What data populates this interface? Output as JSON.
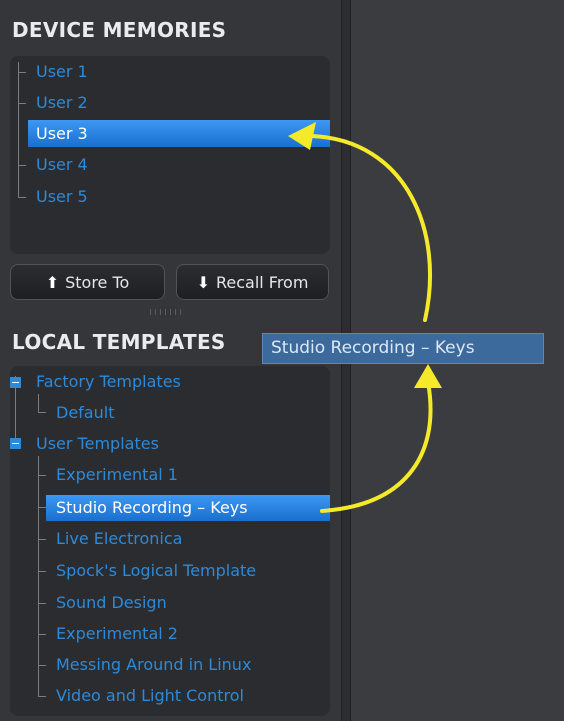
{
  "device_memories": {
    "title": "DEVICE MEMORIES",
    "items": [
      "User 1",
      "User 2",
      "User 3",
      "User 4",
      "User 5"
    ],
    "selected": "User 3"
  },
  "buttons": {
    "store_label": "Store To",
    "recall_label": "Recall From"
  },
  "local_templates": {
    "title": "LOCAL TEMPLATES",
    "groups": [
      {
        "label": "Factory Templates",
        "children": [
          "Default"
        ]
      },
      {
        "label": "User Templates",
        "children": [
          "Experimental 1",
          "Studio Recording – Keys",
          "Live Electronica",
          "Spock's Logical Template",
          "Sound Design",
          "Experimental 2",
          "Messing Around in Linux",
          "Video and Light Control"
        ]
      }
    ],
    "selected": "Studio Recording – Keys"
  },
  "drag_label": "Studio Recording – Keys",
  "colors": {
    "accent": "#2d8ad8",
    "selection": "#2a7fe0",
    "annotation_arrow": "#f5ea2a",
    "panel_bg": "#2a2c30"
  },
  "icons": {
    "store": "up-arrow-icon",
    "recall": "down-arrow-icon",
    "expanded": "minus-box-icon"
  }
}
